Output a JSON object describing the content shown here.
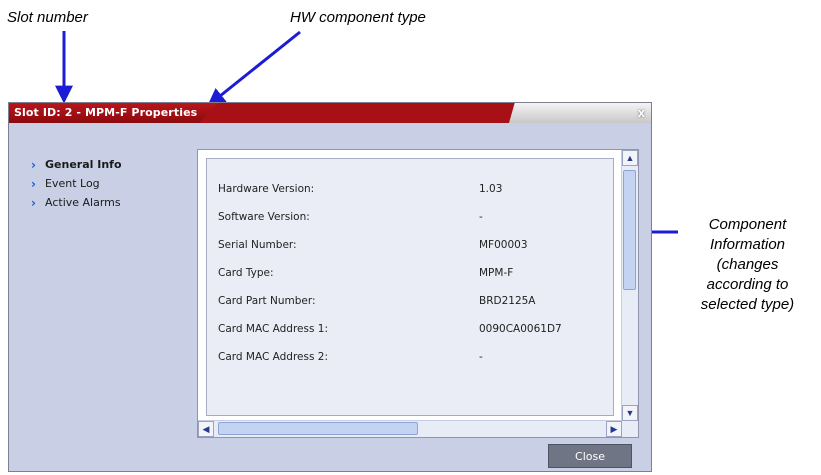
{
  "annotations": {
    "slot": "Slot number",
    "hw": "HW component type",
    "component_lines": [
      "Component",
      "Information",
      "(changes",
      "according to",
      "selected type)"
    ]
  },
  "window": {
    "title": "Slot ID: 2 - MPM-F Properties",
    "close_glyph": "x"
  },
  "nav": {
    "items": [
      {
        "label": "General Info",
        "active": true
      },
      {
        "label": "Event Log",
        "active": false
      },
      {
        "label": "Active Alarms",
        "active": false
      }
    ]
  },
  "info": {
    "rows": [
      {
        "label": "Hardware Version:",
        "value": "1.03"
      },
      {
        "label": "Software Version:",
        "value": "-"
      },
      {
        "label": "Serial Number:",
        "value": "MF00003"
      },
      {
        "label": "Card Type:",
        "value": "MPM-F"
      },
      {
        "label": "Card Part Number:",
        "value": "BRD2125A"
      },
      {
        "label": "Card MAC Address 1:",
        "value": "0090CA0061D7"
      },
      {
        "label": "Card MAC Address 2:",
        "value": "-"
      }
    ]
  },
  "footer": {
    "close_label": "Close"
  },
  "colors": {
    "titlebar": "#a71116",
    "body": "#c9d0e6",
    "arrow": "#1c1cd6"
  }
}
